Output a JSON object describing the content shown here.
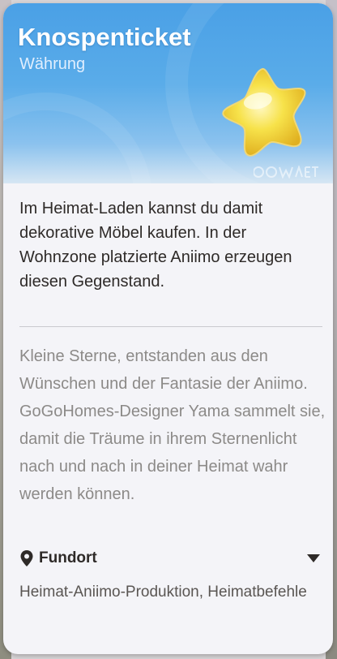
{
  "item": {
    "name": "Knospenticket",
    "category": "Währung",
    "description": "Im Heimat-Laden kannst du damit dekorative Möbel kaufen. In der Wohnzone platzierte Aniimo erzeugen diesen Gegenstand.",
    "lore": "Kleine Sterne, entstanden aus den Wünschen und der Fantasie der Aniimo. GoGoHomes-Designer Yama sammelt sie, damit die Träume in ihrem Sternenlicht nach und nach in deiner Heimat wahr werden können."
  },
  "source": {
    "label": "Fundort",
    "value": "Heimat-Aniimo-Produktion, Heimatbefehle"
  },
  "colors": {
    "header_blue": "#4aa0e6",
    "star_yellow": "#f5d84a",
    "text_dark": "#2e2a28",
    "text_muted": "#8c8a88"
  },
  "icons": {
    "item": "star-icon",
    "source": "location-pin-icon",
    "expand": "chevron-down-icon"
  }
}
